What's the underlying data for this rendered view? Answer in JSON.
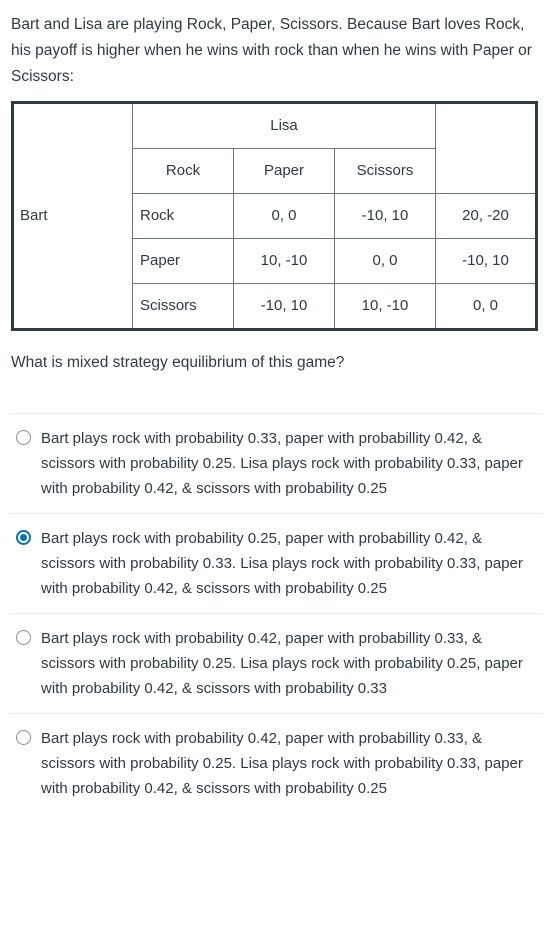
{
  "prompt": "Bart and Lisa are playing Rock, Paper, Scissors. Because Bart loves Rock, his payoff is higher when he wins with rock than when he wins with Paper or Scissors:",
  "matrix": {
    "row_player": "Bart",
    "col_player": "Lisa",
    "blank_corner": "",
    "col_headers": [
      "Rock",
      "Paper",
      "Scissors"
    ],
    "row_headers": [
      "Rock",
      "Paper",
      "Scissors"
    ],
    "cells": [
      [
        "0, 0",
        "-10, 10",
        "20, -20"
      ],
      [
        "10, -10",
        "0, 0",
        "-10, 10"
      ],
      [
        "-10, 10",
        "10, -10",
        "0, 0"
      ]
    ]
  },
  "subquestion": "What is mixed strategy equilibrium of this game?",
  "answers": [
    {
      "text": "Bart plays rock with probability 0.33, paper with probabillity 0.42, & scissors with probability 0.25. Lisa plays rock with probability 0.33, paper with probability 0.42, & scissors with probability 0.25",
      "selected": false
    },
    {
      "text": "Bart plays rock with probability 0.25, paper with probabillity 0.42, & scissors with probability 0.33. Lisa plays rock with probability 0.33, paper with probability 0.42, & scissors with probability 0.25",
      "selected": true
    },
    {
      "text": "Bart plays rock with probability 0.42, paper with probabillity 0.33, & scissors with probability 0.25. Lisa plays rock with probability 0.25, paper with probability 0.42, & scissors with probability 0.33",
      "selected": false
    },
    {
      "text": "Bart plays rock with probability 0.42, paper with probabillity 0.33, & scissors with probability 0.25. Lisa plays rock with probability 0.33, paper with probability 0.42, & scissors with probability 0.25",
      "selected": false
    }
  ],
  "colors": {
    "text": "#2D3B45",
    "accent": "#0374B5",
    "table_border": "#2D3B45",
    "table_inner_border": "#6b7780",
    "divider": "#e8eaec",
    "radio_unselected": "#8a9199"
  }
}
